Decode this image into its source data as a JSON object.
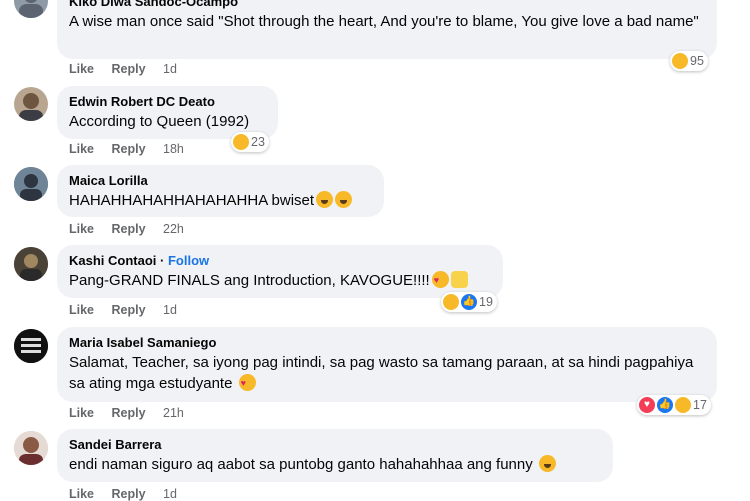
{
  "comments": [
    {
      "author": "Kiko Diwa Sandoc-Ocampo",
      "text": "A wise man once said \"Shot through the heart, And you're to blame, You give love a bad name\"",
      "like": "Like",
      "reply": "Reply",
      "time": "1d",
      "reaction_count": "95"
    },
    {
      "author": "Edwin Robert DC Deato",
      "text": "According to Queen (1992)",
      "like": "Like",
      "reply": "Reply",
      "time": "18h",
      "reaction_count": "23"
    },
    {
      "author": "Maica Lorilla",
      "text": "HAHAHHAHAHHAHAHAHHA bwiset",
      "like": "Like",
      "reply": "Reply",
      "time": "22h"
    },
    {
      "author": "Kashi Contaoi",
      "follow": "Follow",
      "text": "Pang-GRAND FINALS ang Introduction, KAVOGUE!!!!",
      "like": "Like",
      "reply": "Reply",
      "time": "1d",
      "reaction_count": "19"
    },
    {
      "author": "Maria Isabel Samaniego",
      "text": "Salamat, Teacher, sa iyong pag intindi, sa pag wasto sa tamang paraan, at sa hindi pagpahiya sa ating mga estudyante",
      "like": "Like",
      "reply": "Reply",
      "time": "21h",
      "reaction_count": "17"
    },
    {
      "author": "Sandei Barrera",
      "text": "endi naman siguro aq aabot sa puntobg ganto hahahahhaa ang funny",
      "like": "Like",
      "reply": "Reply",
      "time": "1d"
    }
  ],
  "colors": {
    "bubble": "#f0f2f5",
    "meta": "#65676b",
    "link": "#1b74e4",
    "haha": "#f7b928",
    "love": "#f33e58",
    "like": "#1877f2"
  },
  "icons": [
    "haha-reaction-icon",
    "love-reaction-icon",
    "like-reaction-icon"
  ]
}
